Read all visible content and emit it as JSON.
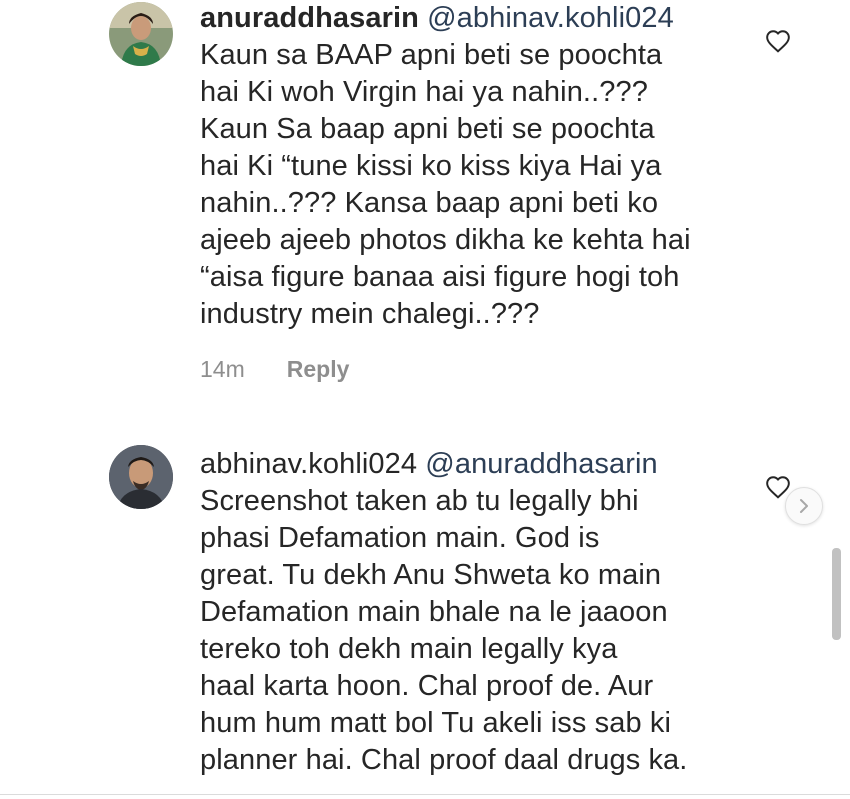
{
  "comments": [
    {
      "username": "anuraddhasarin",
      "mention": "@abhinav.kohli024",
      "text_lines": [
        "Kaun sa BAAP apni beti se poochta",
        "hai Ki woh Virgin hai ya nahin..???",
        "Kaun Sa baap apni beti se poochta",
        "hai Ki “tune kissi ko kiss kiya Hai ya",
        "nahin..??? Kansa baap apni beti ko",
        "ajeeb ajeeb photos dikha ke kehta hai",
        "“aisa figure banaa aisi figure hogi toh",
        "industry mein chalegi..???"
      ],
      "time": "14m",
      "reply_label": "Reply",
      "like_icon": "heart-outline-icon"
    },
    {
      "username": "abhinav.kohli024",
      "mention": "@anuraddhasarin",
      "text_lines": [
        "Screenshot taken ab tu legally bhi",
        "phasi Defamation main. God is",
        "great. Tu dekh Anu Shweta ko main",
        "Defamation main bhale na le jaaoon",
        "tereko toh dekh main legally kya",
        "haal karta hoon. Chal proof de. Aur",
        "hum hum matt bol Tu akeli iss sab ki",
        "planner hai. Chal proof daal drugs ka."
      ],
      "like_icon": "heart-outline-icon"
    }
  ],
  "colors": {
    "text": "#262626",
    "meta": "#8e8e8e",
    "mention": "#2c3e55",
    "background": "#ffffff"
  },
  "icons": {
    "next": "chevron-right-icon"
  }
}
